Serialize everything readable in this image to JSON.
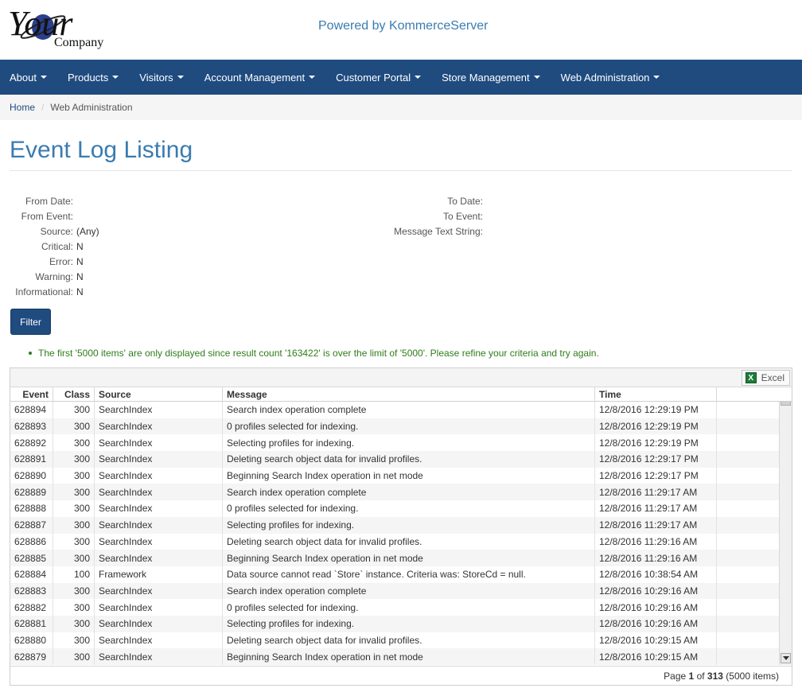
{
  "header": {
    "logo_text_big": "Your",
    "logo_text_small": "Company",
    "powered_by": "Powered by KommerceServer"
  },
  "nav": [
    {
      "label": "About"
    },
    {
      "label": "Products"
    },
    {
      "label": "Visitors"
    },
    {
      "label": "Account Management"
    },
    {
      "label": "Customer Portal"
    },
    {
      "label": "Store Management"
    },
    {
      "label": "Web Administration"
    }
  ],
  "breadcrumb": {
    "home": "Home",
    "separator": "/",
    "current": "Web Administration"
  },
  "page_title": "Event Log Listing",
  "criteria": {
    "left": [
      {
        "label": "From Date:",
        "value": ""
      },
      {
        "label": "From Event:",
        "value": ""
      },
      {
        "label": "Source:",
        "value": "(Any)"
      },
      {
        "label": "Critical:",
        "value": "N"
      },
      {
        "label": "Error:",
        "value": "N"
      },
      {
        "label": "Warning:",
        "value": "N"
      },
      {
        "label": "Informational:",
        "value": "N"
      }
    ],
    "right": [
      {
        "label": "To Date:",
        "value": ""
      },
      {
        "label": "To Event:",
        "value": ""
      },
      {
        "label": "Message Text String:",
        "value": ""
      }
    ]
  },
  "filter_label": "Filter",
  "notice": "The first '5000 items' are only displayed since result count '163422' is over the limit of '5000'. Please refine your criteria and try again.",
  "grid": {
    "excel_label": "Excel",
    "columns": {
      "event": "Event",
      "class": "Class",
      "source": "Source",
      "message": "Message",
      "time": "Time"
    },
    "rows": [
      {
        "event": "628894",
        "class": "300",
        "source": "SearchIndex",
        "message": "Search index operation complete",
        "time": "12/8/2016 12:29:19 PM"
      },
      {
        "event": "628893",
        "class": "300",
        "source": "SearchIndex",
        "message": "0 profiles selected for indexing.",
        "time": "12/8/2016 12:29:19 PM"
      },
      {
        "event": "628892",
        "class": "300",
        "source": "SearchIndex",
        "message": "Selecting profiles for indexing.",
        "time": "12/8/2016 12:29:19 PM"
      },
      {
        "event": "628891",
        "class": "300",
        "source": "SearchIndex",
        "message": "Deleting search object data for invalid profiles.",
        "time": "12/8/2016 12:29:17 PM"
      },
      {
        "event": "628890",
        "class": "300",
        "source": "SearchIndex",
        "message": "Beginning Search Index operation in net mode",
        "time": "12/8/2016 12:29:17 PM"
      },
      {
        "event": "628889",
        "class": "300",
        "source": "SearchIndex",
        "message": "Search index operation complete",
        "time": "12/8/2016 11:29:17 AM"
      },
      {
        "event": "628888",
        "class": "300",
        "source": "SearchIndex",
        "message": "0 profiles selected for indexing.",
        "time": "12/8/2016 11:29:17 AM"
      },
      {
        "event": "628887",
        "class": "300",
        "source": "SearchIndex",
        "message": "Selecting profiles for indexing.",
        "time": "12/8/2016 11:29:17 AM"
      },
      {
        "event": "628886",
        "class": "300",
        "source": "SearchIndex",
        "message": "Deleting search object data for invalid profiles.",
        "time": "12/8/2016 11:29:16 AM"
      },
      {
        "event": "628885",
        "class": "300",
        "source": "SearchIndex",
        "message": "Beginning Search Index operation in net mode",
        "time": "12/8/2016 11:29:16 AM"
      },
      {
        "event": "628884",
        "class": "100",
        "source": "Framework",
        "message": "Data source cannot read `Store` instance. Criteria was: StoreCd = null.",
        "time": "12/8/2016 10:38:54 AM"
      },
      {
        "event": "628883",
        "class": "300",
        "source": "SearchIndex",
        "message": "Search index operation complete",
        "time": "12/8/2016 10:29:16 AM"
      },
      {
        "event": "628882",
        "class": "300",
        "source": "SearchIndex",
        "message": "0 profiles selected for indexing.",
        "time": "12/8/2016 10:29:16 AM"
      },
      {
        "event": "628881",
        "class": "300",
        "source": "SearchIndex",
        "message": "Selecting profiles for indexing.",
        "time": "12/8/2016 10:29:16 AM"
      },
      {
        "event": "628880",
        "class": "300",
        "source": "SearchIndex",
        "message": "Deleting search object data for invalid profiles.",
        "time": "12/8/2016 10:29:15 AM"
      },
      {
        "event": "628879",
        "class": "300",
        "source": "SearchIndex",
        "message": "Beginning Search Index operation in net mode",
        "time": "12/8/2016 10:29:15 AM"
      }
    ],
    "footer": {
      "page_prefix": "Page",
      "page_current": "1",
      "page_of": "of",
      "page_total": "313",
      "items_text": "(5000 items)"
    }
  },
  "colors": {
    "nav_bg": "#1f4b7f",
    "title_blue": "#3a7bb0",
    "notice_green": "#2e7d1a"
  }
}
